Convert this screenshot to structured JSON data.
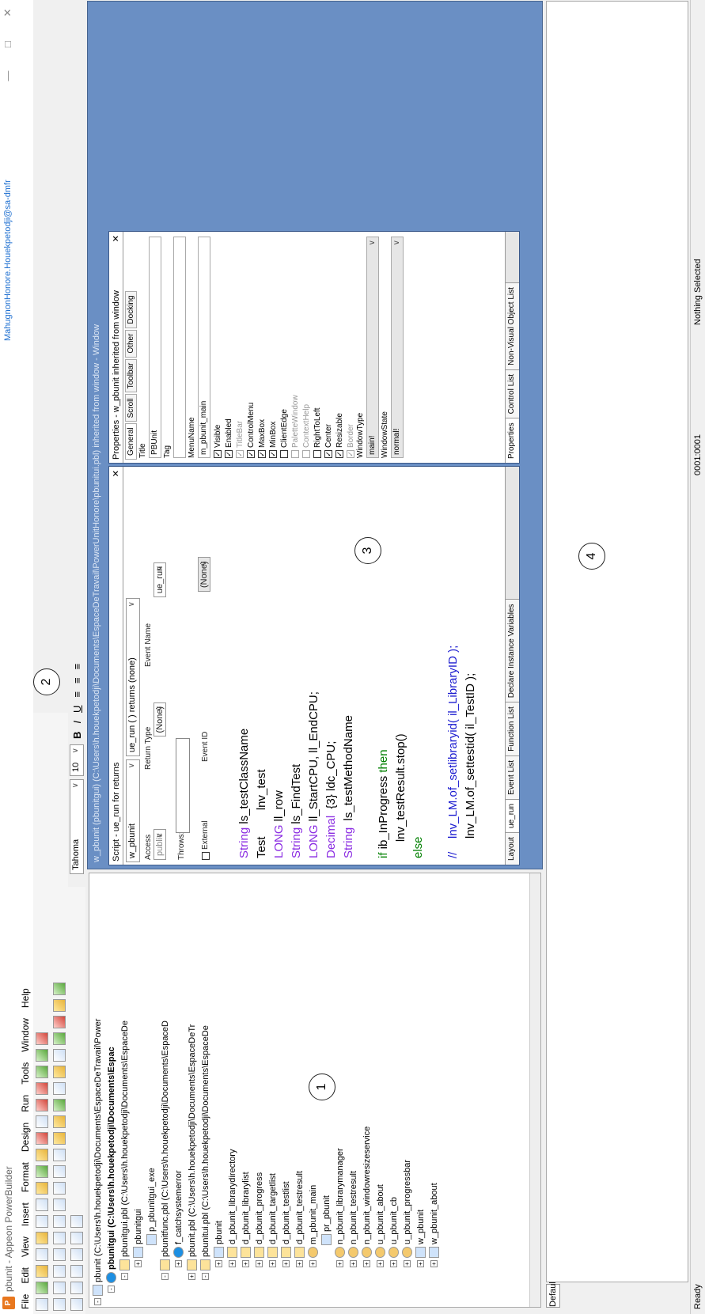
{
  "app": {
    "title": "pbunit - Appeon PowerBuilder",
    "user": "MahugnonHonore.Houekpetodji@sa-dmfr"
  },
  "window_controls": {
    "close": "✕",
    "maximize": "□",
    "minimize": "—"
  },
  "menu": [
    "File",
    "Edit",
    "View",
    "Insert",
    "Format",
    "Design",
    "Run",
    "Tools",
    "Window",
    "Help"
  ],
  "font_toolbar": {
    "font": "Tahoma",
    "size": "10",
    "bold": "B",
    "italic": "I",
    "underline": "U"
  },
  "tree": [
    {
      "label": "pbunit (C:\\Users\\h.houekpetodji\\Documents\\EspaceDeTravail\\Power",
      "icon": "workspace",
      "ex": "-"
    },
    {
      "label": "pbunitgui (C:\\Users\\h.houekpetodji\\Documents\\Espac",
      "icon": "target",
      "ex": "-",
      "bold": true
    },
    {
      "label": "pbunitgui.pbl (C:\\Users\\h.houekpetodji\\Documents\\EspaceDe",
      "icon": "library",
      "ex": "-"
    },
    {
      "label": "pbunitgui",
      "icon": "app",
      "ex": "+"
    },
    {
      "label": "p_pbunitgui_exe",
      "icon": "project",
      "ex": ""
    },
    {
      "label": "pbunitfunc.pbl (C:\\Users\\h.houekpetodji\\Documents\\EspaceD",
      "icon": "library",
      "ex": "-"
    },
    {
      "label": "f_catchsystemerror",
      "icon": "function",
      "ex": "+"
    },
    {
      "label": "pbunit.pbl (C:\\Users\\h.houekpetodji\\Documents\\EspaceDeTr",
      "icon": "library",
      "ex": "+"
    },
    {
      "label": "pbunitui.pbl (C:\\Users\\h.houekpetodji\\Documents\\EspaceDe",
      "icon": "library",
      "ex": "-"
    },
    {
      "label": "pbunit",
      "icon": "app",
      "ex": "+"
    },
    {
      "label": "d_pbunit_librarydirectory",
      "icon": "datawindow",
      "ex": "+"
    },
    {
      "label": "d_pbunit_librarylist",
      "icon": "datawindow",
      "ex": "+"
    },
    {
      "label": "d_pbunit_progress",
      "icon": "datawindow",
      "ex": "+"
    },
    {
      "label": "d_pbunit_targetlist",
      "icon": "datawindow",
      "ex": "+"
    },
    {
      "label": "d_pbunit_testlist",
      "icon": "datawindow",
      "ex": "+"
    },
    {
      "label": "d_pbunit_testresult",
      "icon": "datawindow",
      "ex": "+"
    },
    {
      "label": "m_pbunit_main",
      "icon": "menu",
      "ex": "+"
    },
    {
      "label": "pr_pbunit",
      "icon": "project",
      "ex": ""
    },
    {
      "label": "n_pbunit_librarymanager",
      "icon": "nvo",
      "ex": "+"
    },
    {
      "label": "n_pbunit_testresult",
      "icon": "nvo",
      "ex": "+"
    },
    {
      "label": "n_pbunit_windowresizeservice",
      "icon": "nvo",
      "ex": "+"
    },
    {
      "label": "u_pbunit_about",
      "icon": "nvo",
      "ex": "+"
    },
    {
      "label": "u_pbunit_cb",
      "icon": "nvo",
      "ex": "+"
    },
    {
      "label": "u_pbunit_progressbar",
      "icon": "nvo",
      "ex": "+"
    },
    {
      "label": "w_pbunit",
      "icon": "window",
      "ex": "+"
    },
    {
      "label": "w_pbunit_about",
      "icon": "window",
      "ex": "+"
    }
  ],
  "mdi_title": "w_pbunit (pbunitgui) (C:\\Users\\h.houekpetodji\\Documents\\EspaceDeTravail\\PowerUnitHonore\\pbunitui.pbl) inherited from window - Window",
  "script": {
    "title": "Script - ue_run for returns",
    "object": "w_pbunit",
    "event": "ue_run ( ) returns (none)",
    "access_label": "Access",
    "access": "public",
    "return_label": "Return Type",
    "return_type": "(None)",
    "event_name_label": "Event Name",
    "event_name": "ue_run",
    "throws_label": "Throws:",
    "external_label": "External",
    "event_id_label": "Event ID",
    "event_id": "(None)",
    "code": [
      [
        {
          "t": "String",
          "c": "k"
        },
        {
          "t": " ls_testClassName"
        }
      ],
      [
        {
          "t": "Test        lnv_test"
        }
      ],
      [
        {
          "t": "LONG",
          "c": "k"
        },
        {
          "t": " ll_row"
        }
      ],
      [
        {
          "t": "String",
          "c": "k"
        },
        {
          "t": " ls_FindTest"
        }
      ],
      [
        {
          "t": "LONG",
          "c": "k"
        },
        {
          "t": " ll_StartCPU, ll_EndCPU;"
        }
      ],
      [
        {
          "t": "Decimal",
          "c": "k"
        },
        {
          "t": "  {3} ldc_CPU;"
        }
      ],
      [
        {
          "t": "String",
          "c": "k"
        },
        {
          "t": "  ls_testMethodName"
        }
      ],
      [
        {
          "t": ""
        }
      ],
      [
        {
          "t": "if",
          "c": "g"
        },
        {
          "t": " ib_InProgress "
        },
        {
          "t": "then",
          "c": "g"
        }
      ],
      [
        {
          "t": "     lnv_testResult.stop()"
        }
      ],
      [
        {
          "t": "else",
          "c": "g"
        }
      ],
      [
        {
          "t": ""
        }
      ],
      [
        {
          "t": "//    lnv_LM.of_setlibraryid( il_LibraryID );",
          "c": "b"
        }
      ],
      [
        {
          "t": "      lnv_LM.of_settestid( il_TestID );"
        }
      ]
    ],
    "tabs": [
      "Layout",
      "ue_run",
      "Event List",
      "Function List",
      "Declare Instance Variables"
    ]
  },
  "properties": {
    "title": "Properties - w_pbunit inherited from window",
    "tabs": [
      "General",
      "Scroll",
      "Toolbar",
      "Other",
      "Docking"
    ],
    "title_label": "Title",
    "title_value": "PBUnit",
    "tag_label": "Tag",
    "tag_value": "",
    "menu_label": "MenuName",
    "menu_value": "m_pbunit_main",
    "checks": [
      {
        "label": "Visible",
        "on": true,
        "dis": false
      },
      {
        "label": "Enabled",
        "on": true,
        "dis": false
      },
      {
        "label": "TitleBar",
        "on": true,
        "dis": true
      },
      {
        "label": "ControlMenu",
        "on": true,
        "dis": false
      },
      {
        "label": "MaxBox",
        "on": true,
        "dis": false
      },
      {
        "label": "MinBox",
        "on": true,
        "dis": false
      },
      {
        "label": "ClientEdge",
        "on": false,
        "dis": false
      },
      {
        "label": "PaletteWindow",
        "on": false,
        "dis": true
      },
      {
        "label": "ContextHelp",
        "on": false,
        "dis": true
      },
      {
        "label": "RightToLeft",
        "on": false,
        "dis": false
      },
      {
        "label": "Center",
        "on": true,
        "dis": false
      },
      {
        "label": "Resizable",
        "on": true,
        "dis": false
      },
      {
        "label": "Border",
        "on": true,
        "dis": true
      }
    ],
    "windowtype_label": "WindowType",
    "windowtype": "main!",
    "windowstate_label": "WindowState",
    "windowstate": "normal!",
    "bottom_tabs": [
      "Properties",
      "Control List",
      "Non-Visual Object List"
    ]
  },
  "bottom": {
    "tab": "Default"
  },
  "status": {
    "ready": "Ready",
    "position": "0001:0001",
    "selection": "Nothing Selected"
  },
  "markers": [
    "1",
    "2",
    "3",
    "4"
  ]
}
